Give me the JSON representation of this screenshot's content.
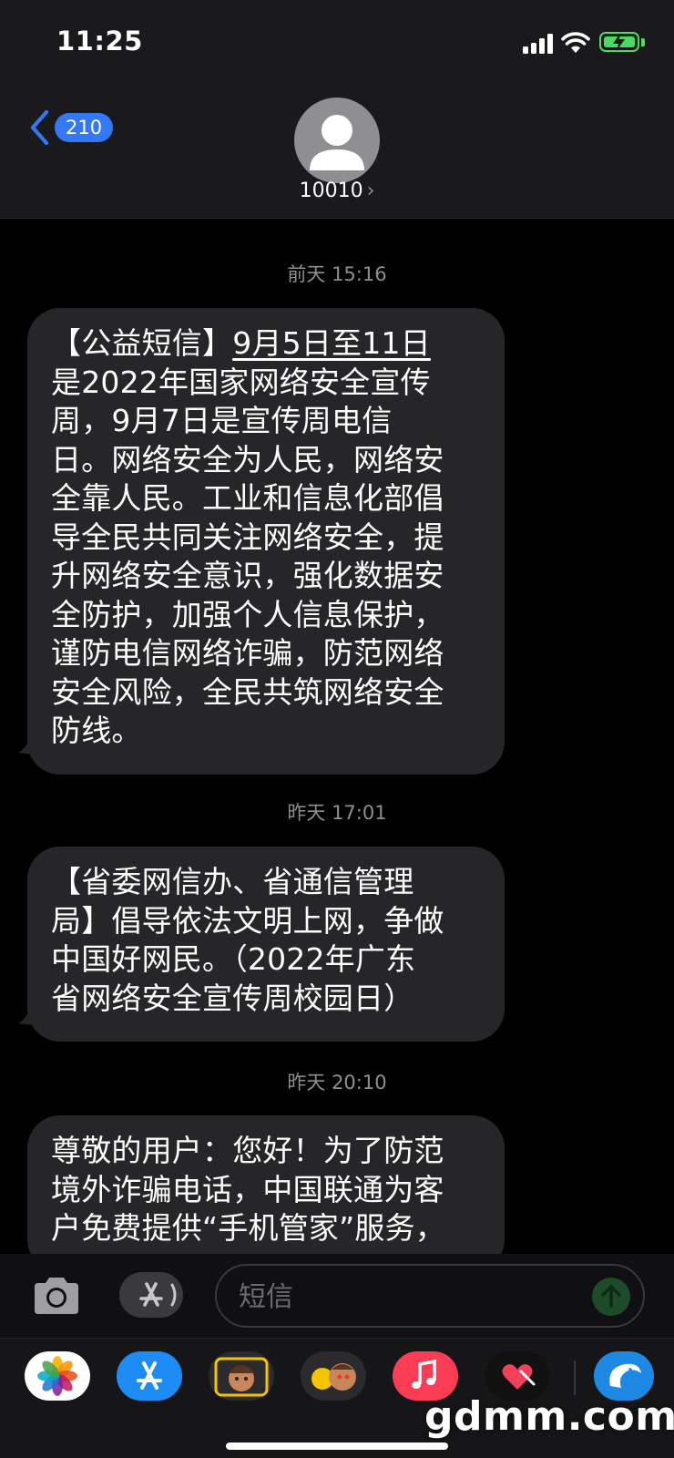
{
  "status_bar": {
    "time": "11:25"
  },
  "nav": {
    "back_count": "210",
    "contact_name": "10010",
    "chevron": "›"
  },
  "messages": [
    {
      "timestamp": "前天 15:16",
      "lines": [
        {
          "pre": "【公益短信】",
          "ul": "9月5日至11日"
        },
        {
          "pre": "是2022年国家网络安全宣传"
        },
        {
          "pre": "周，9月7日是宣传周电信"
        },
        {
          "pre": "日。网络安全为人民，网络安"
        },
        {
          "pre": "全靠人民。工业和信息化部倡"
        },
        {
          "pre": "导全民共同关注网络安全，提"
        },
        {
          "pre": "升网络安全意识，强化数据安"
        },
        {
          "pre": "全防护，加强个人信息保护，"
        },
        {
          "pre": "谨防电信网络诈骗，防范网络"
        },
        {
          "pre": "安全风险，全民共筑网络安全"
        },
        {
          "pre": "防线。"
        }
      ]
    },
    {
      "timestamp": "昨天 17:01",
      "lines": [
        {
          "pre": "【省委网信办、省通信管理"
        },
        {
          "pre": "局】倡导依法文明上网，争做"
        },
        {
          "pre": "中国好网民。（2022年广东"
        },
        {
          "pre": "省网络安全宣传周校园日）"
        }
      ]
    },
    {
      "timestamp": "昨天 20:10",
      "lines": [
        {
          "pre": "尊敬的用户：您好！为了防范"
        },
        {
          "pre": "境外诈骗电话，中国联通为客"
        },
        {
          "pre": "户免费提供“手机管家”服务，"
        }
      ]
    }
  ],
  "input": {
    "placeholder": "短信"
  },
  "drawer": {
    "apps": [
      {
        "icon": "photos-icon"
      },
      {
        "icon": "app-store-icon"
      },
      {
        "icon": "memoji-icon"
      },
      {
        "icon": "animoji-icon"
      },
      {
        "icon": "music-icon"
      },
      {
        "icon": "digital-touch-icon"
      },
      {
        "icon": "dolphin-app-icon"
      }
    ],
    "watermark": "gdmm.com"
  },
  "colors": {
    "accent": "#3478f6",
    "bubble": "#262628",
    "background": "#000000",
    "battery": "#4cd964"
  }
}
